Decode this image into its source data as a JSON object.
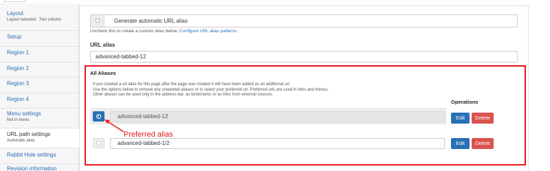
{
  "sidebar": {
    "items": [
      {
        "label": "Layout",
        "sub": "Layout selected : Two column"
      },
      {
        "label": "Setup",
        "sub": ""
      },
      {
        "label": "Region 1",
        "sub": ""
      },
      {
        "label": "Region 2",
        "sub": ""
      },
      {
        "label": "Region 3",
        "sub": ""
      },
      {
        "label": "Region 4",
        "sub": ""
      },
      {
        "label": "Menu settings",
        "sub": "Not in menu"
      },
      {
        "label": "URL path settings",
        "sub": "Automatic alias"
      },
      {
        "label": "Rabbit Hole settings",
        "sub": ""
      },
      {
        "label": "Revision information",
        "sub": ""
      }
    ]
  },
  "main": {
    "generate_label": "Generate automatic URL alias",
    "help_text": "Uncheck this to create a custom alias below.",
    "help_link": "Configure URL alias patterns.",
    "url_alias_label": "URL alias",
    "url_alias_value": "advanced-tabbed-12"
  },
  "aliases": {
    "title": "All Aliases",
    "description": [
      "If you created a url alias for this page after the page was created it will have been added as an additional url.",
      "Use the options below to remove any unwanted aliases or to select your preferred url. Preferred urls are used in links and menus.",
      "Other aliases can be used only in the address bar, as bookmarks or as links from external sources."
    ],
    "operations_header": "Operations",
    "rows": [
      {
        "alias": "advanced-tabbed-12",
        "preferred": true,
        "edit_label": "Edit",
        "delete_label": "Delete"
      },
      {
        "alias": "advanced-tabbed-1/2",
        "preferred": false,
        "edit_label": "Edit",
        "delete_label": "Delete"
      }
    ],
    "annotation": "Preferred alias"
  },
  "colors": {
    "accent": "#2b6fb6",
    "danger": "#d9534f",
    "highlight": "#e8141a"
  }
}
